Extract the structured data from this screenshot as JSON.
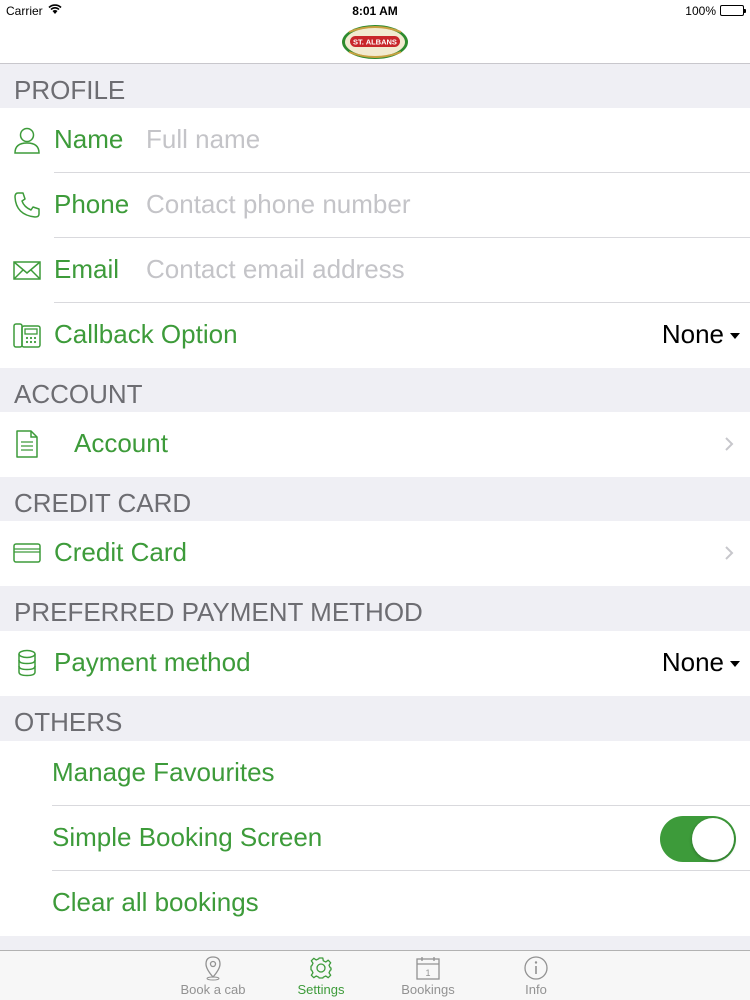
{
  "status_bar": {
    "carrier": "Carrier",
    "time": "8:01 AM",
    "battery": "100%"
  },
  "nav": {
    "logo_text": "ST. ALBANS"
  },
  "sections": {
    "profile": "PROFILE",
    "account": "ACCOUNT",
    "credit_card": "CREDIT CARD",
    "payment": "PREFERRED PAYMENT METHOD",
    "others": "OTHERS"
  },
  "profile": {
    "name_label": "Name",
    "name_placeholder": "Full name",
    "phone_label": "Phone",
    "phone_placeholder": "Contact phone number",
    "email_label": "Email",
    "email_placeholder": "Contact email address",
    "callback_label": "Callback Option",
    "callback_value": "None"
  },
  "account": {
    "label": "Account"
  },
  "credit_card": {
    "label": "Credit Card"
  },
  "payment": {
    "label": "Payment method",
    "value": "None"
  },
  "others": {
    "manage_favourites": "Manage Favourites",
    "simple_booking": "Simple Booking Screen",
    "simple_booking_on": true,
    "clear_bookings": "Clear all bookings"
  },
  "tabs": [
    {
      "label": "Book a cab",
      "icon": "map-pin-icon",
      "active": false
    },
    {
      "label": "Settings",
      "icon": "gear-icon",
      "active": true
    },
    {
      "label": "Bookings",
      "icon": "calendar-icon",
      "active": false
    },
    {
      "label": "Info",
      "icon": "info-icon",
      "active": false
    }
  ],
  "colors": {
    "accent": "#3d9b3a",
    "placeholder": "#c4c4c8",
    "section_text": "#6d6d72",
    "background": "#efeff4"
  }
}
